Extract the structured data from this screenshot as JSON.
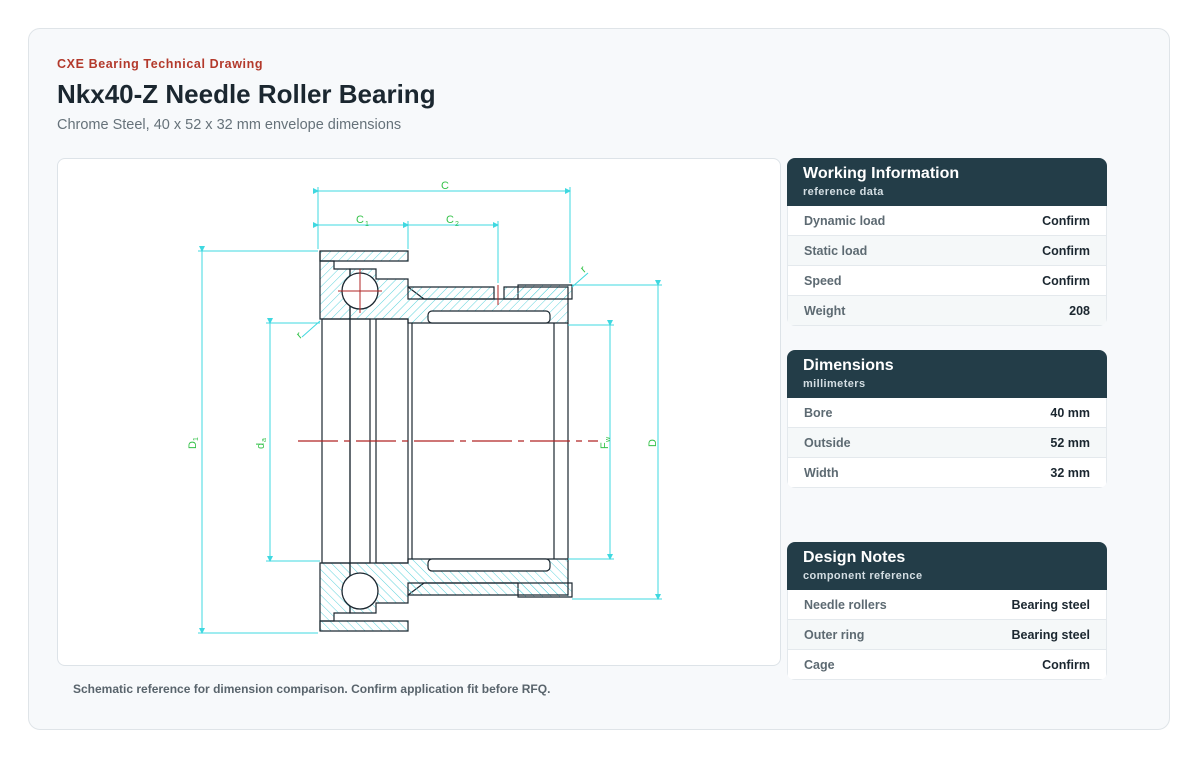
{
  "header": {
    "eyebrow": "CXE Bearing Technical Drawing",
    "title": "Nkx40-Z Needle Roller Bearing",
    "subtitle": "Chrome Steel, 40 x 52 x 32 mm envelope dimensions"
  },
  "drawing": {
    "labels": {
      "C": "C",
      "C1": "C",
      "C1_sub": "1",
      "C2": "C",
      "C2_sub": "2",
      "D1": "D",
      "D1_sub": "1",
      "da": "d",
      "da_sub": "a",
      "Fw": "F",
      "Fw_sub": "w",
      "D": "D",
      "r_top": "r",
      "r_left": "r"
    },
    "caption": "Schematic reference for dimension comparison. Confirm application fit before RFQ."
  },
  "panels": {
    "working": {
      "title": "Working Information",
      "subtitle": "reference data",
      "rows": [
        {
          "label": "Dynamic load",
          "value": "Confirm"
        },
        {
          "label": "Static load",
          "value": "Confirm"
        },
        {
          "label": "Speed",
          "value": "Confirm"
        },
        {
          "label": "Weight",
          "value": "208"
        }
      ]
    },
    "dimensions": {
      "title": "Dimensions",
      "subtitle": "millimeters",
      "rows": [
        {
          "label": "Bore",
          "value": "40 mm"
        },
        {
          "label": "Outside",
          "value": "52 mm"
        },
        {
          "label": "Width",
          "value": "32 mm"
        }
      ]
    },
    "notes": {
      "title": "Design Notes",
      "subtitle": "component reference",
      "rows": [
        {
          "label": "Needle rollers",
          "value": "Bearing steel"
        },
        {
          "label": "Outer ring",
          "value": "Bearing steel"
        },
        {
          "label": "Cage",
          "value": "Confirm"
        }
      ]
    }
  },
  "colors": {
    "accent": "#b3392b",
    "panel_header": "#233d48",
    "dimension_line": "#3fd8e0",
    "dimension_text": "#35c24a",
    "centerline": "#b02424"
  }
}
